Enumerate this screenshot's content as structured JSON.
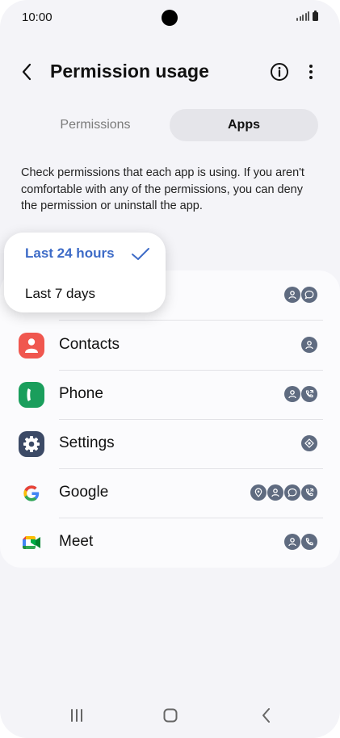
{
  "status_bar": {
    "time": "10:00"
  },
  "header": {
    "title": "Permission usage",
    "back_icon": "back-arrow-icon",
    "info_icon": "info-icon",
    "more_icon": "more-vert-icon"
  },
  "tabs": [
    {
      "label": "Permissions",
      "selected": false
    },
    {
      "label": "Apps",
      "selected": true
    }
  ],
  "description": "Check permissions that each app is using. If you aren't comfortable with any of the permissions, you can deny the permission or uninstall the app.",
  "time_dropdown": {
    "options": [
      {
        "label": "Last 24 hours",
        "selected": true
      },
      {
        "label": "Last 7 days",
        "selected": false
      }
    ]
  },
  "apps": [
    {
      "name": "",
      "permissions": [
        "contacts-permission-icon",
        "message-permission-icon"
      ]
    },
    {
      "name": "Contacts",
      "permissions": [
        "contacts-permission-icon"
      ]
    },
    {
      "name": "Phone",
      "permissions": [
        "contacts-permission-icon",
        "call-log-permission-icon"
      ]
    },
    {
      "name": "Settings",
      "permissions": [
        "nearby-devices-permission-icon"
      ]
    },
    {
      "name": "Google",
      "permissions": [
        "location-permission-icon",
        "contacts-permission-icon",
        "message-permission-icon",
        "call-log-permission-icon"
      ]
    },
    {
      "name": "Meet",
      "permissions": [
        "contacts-permission-icon",
        "phone-permission-icon"
      ]
    }
  ],
  "colors": {
    "accent": "#3d6bc7",
    "background": "#f4f4f8",
    "card": "#fbfbfd",
    "badge": "#5f6b80",
    "contacts_app": "#f0574f",
    "phone_app": "#1a9e5c",
    "settings_app": "#3c4a66"
  }
}
